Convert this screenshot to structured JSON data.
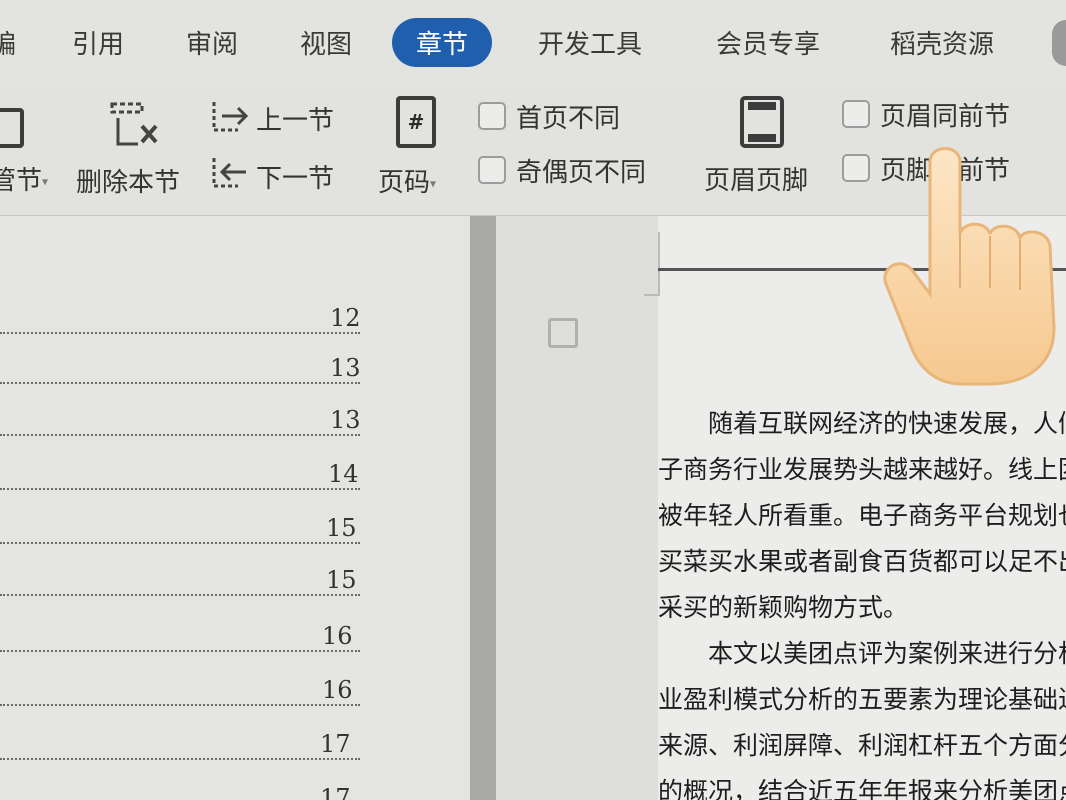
{
  "tabs": [
    {
      "label": "编",
      "active": false
    },
    {
      "label": "引用",
      "active": false
    },
    {
      "label": "审阅",
      "active": false
    },
    {
      "label": "视图",
      "active": false
    },
    {
      "label": "章节",
      "active": true
    },
    {
      "label": "开发工具",
      "active": false
    },
    {
      "label": "会员专享",
      "active": false
    },
    {
      "label": "稻壳资源",
      "active": false
    }
  ],
  "ribbon": {
    "section_label": "管节",
    "delete_section": "删除本节",
    "prev_section": "上一节",
    "next_section": "下一节",
    "page_number": "页码",
    "page_number_icon": "#",
    "first_page_diff": "首页不同",
    "odd_even_diff": "奇偶页不同",
    "header_footer": "页眉页脚",
    "header_same_prev": "页眉同前节",
    "footer_same_prev": "页脚同前节"
  },
  "toc": {
    "page_numbers": [
      "12",
      "13",
      "13",
      "14",
      "15",
      "15",
      "16",
      "16",
      "17",
      "17"
    ]
  },
  "document": {
    "lines": [
      "　　随着互联网经济的快速发展，人们的",
      "子商务行业发展势头越来越好。线上团购",
      "被年轻人所看重。电子商务平台规划也越",
      "买菜买水果或者副食百货都可以足不出户",
      "采买的新颖购物方式。",
      "　　本文以美团点评为案例来进行分析，",
      "业盈利模式分析的五要素为理论基础进行",
      "来源、利润屏障、利润杠杆五个方面分析",
      "的概况，结合近五年年报来分析美团点评"
    ]
  },
  "colors": {
    "active_tab": "#1f5fae",
    "ribbon_bg": "#e2e2df"
  }
}
